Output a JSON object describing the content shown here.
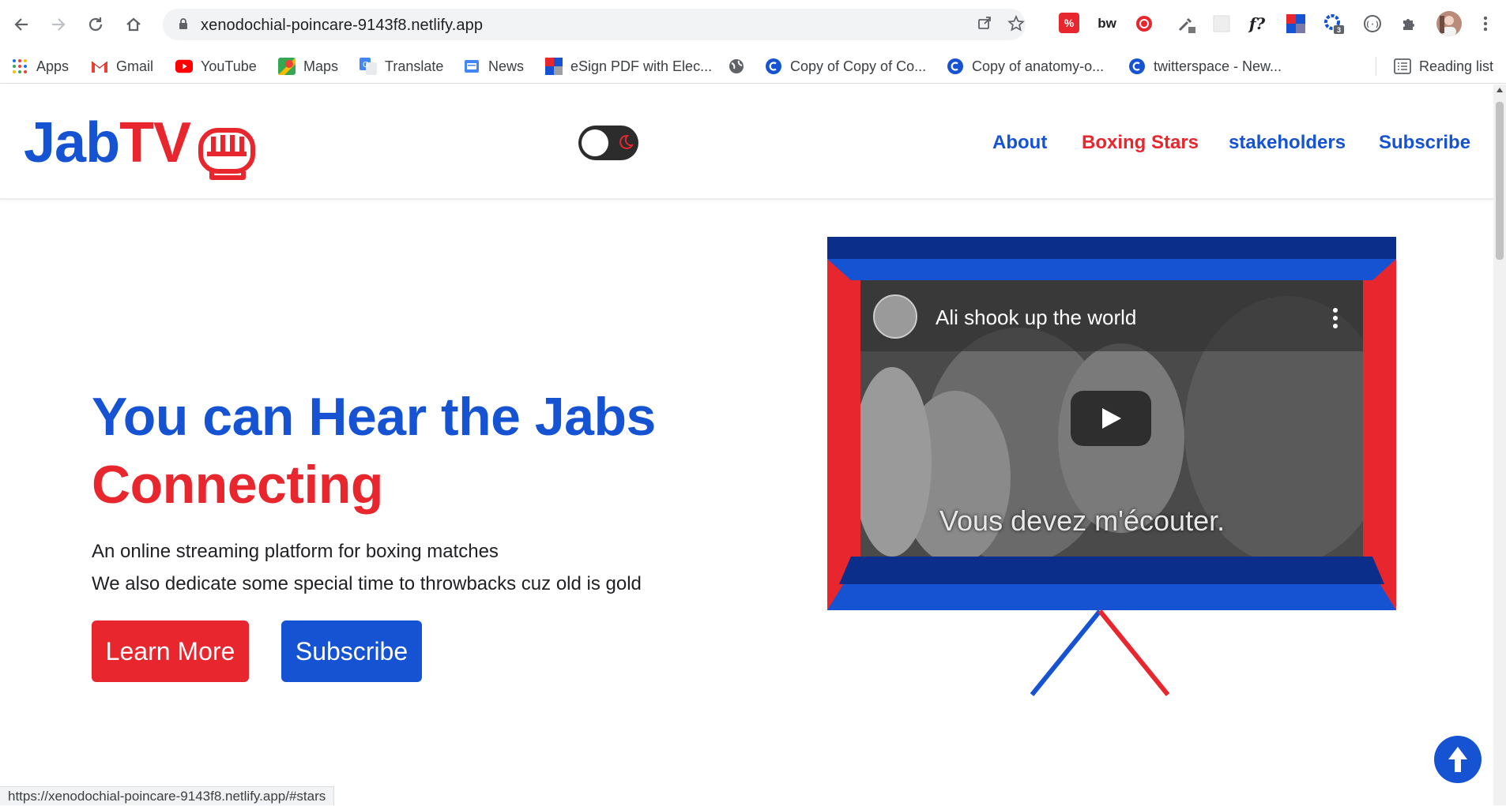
{
  "browser": {
    "url": "xenodochial-poincare-9143f8.netlify.app",
    "status_url": "https://xenodochial-poincare-9143f8.netlify.app/#stars",
    "bookmarks": [
      {
        "label": "Apps",
        "icon": "apps-grid-icon"
      },
      {
        "label": "Gmail",
        "icon": "gmail-icon"
      },
      {
        "label": "YouTube",
        "icon": "youtube-icon"
      },
      {
        "label": "Maps",
        "icon": "maps-icon"
      },
      {
        "label": "Translate",
        "icon": "translate-icon"
      },
      {
        "label": "News",
        "icon": "news-icon"
      },
      {
        "label": "eSign PDF with Elec...",
        "icon": "esign-icon"
      },
      {
        "label": "",
        "icon": "globe-icon"
      },
      {
        "label": "Copy of Copy of Co...",
        "icon": "canva-icon"
      },
      {
        "label": "Copy of anatomy-o...",
        "icon": "canva-icon"
      },
      {
        "label": "twitterspace - New...",
        "icon": "canva-icon"
      }
    ],
    "reading_list": "Reading list",
    "extensions": [
      "percent-extension-icon",
      "bw-extension-icon",
      "record-extension-icon",
      "eyedropper-extension-icon",
      "blank-extension-icon",
      "font-extension-icon",
      "grid-extension-icon",
      "gear-extension-icon",
      "code-extension-icon",
      "puzzle-icon",
      "profile-avatar"
    ],
    "ext_badge": "3"
  },
  "site": {
    "logo_part1": "Jab",
    "logo_part2": "TV",
    "nav": [
      "About",
      "Boxing Stars",
      "stakeholders",
      "Subscribe"
    ],
    "hero_line1": "You can Hear the Jabs",
    "hero_line2": "Connecting",
    "hero_text1": "An online streaming platform for boxing matches",
    "hero_text2": "We also dedicate some special time to throwbacks cuz old is gold",
    "btn_learn": "Learn More",
    "btn_subscribe": "Subscribe",
    "video_title": "Ali shook up the world",
    "video_subtitle": "Vous devez m'écouter.",
    "colors": {
      "blue": "#1553d3",
      "red": "#e8262d",
      "dark_blue": "#0a2e8a"
    }
  }
}
